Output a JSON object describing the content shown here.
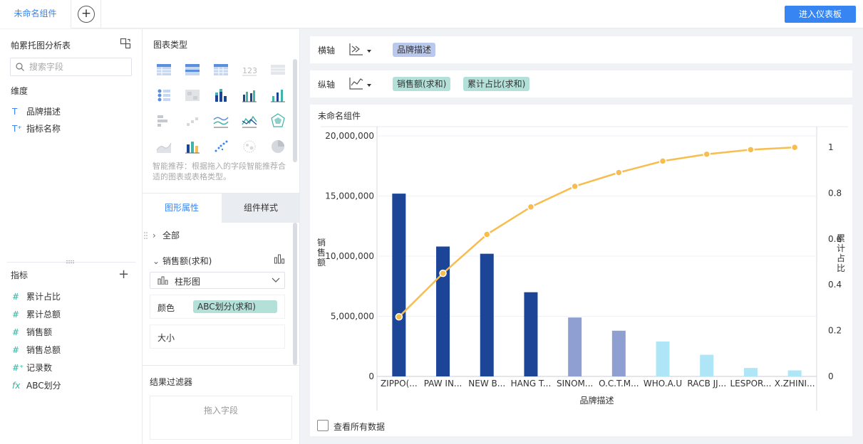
{
  "topbar": {
    "active_tab": "未命名组件",
    "add_tab_symbol": "+",
    "enter_dashboard": "进入仪表板"
  },
  "left_panel": {
    "table_name": "帕累托图分析表",
    "search_placeholder": "搜索字段",
    "dimension_title": "维度",
    "dimensions": [
      {
        "icon": "T",
        "label": "品牌描述"
      },
      {
        "icon": "T⁺",
        "label": "指标名称"
      }
    ],
    "metric_title": "指标",
    "metrics": [
      {
        "icon": "#",
        "label": "累计占比"
      },
      {
        "icon": "#",
        "label": "累计总额"
      },
      {
        "icon": "#",
        "label": "销售额"
      },
      {
        "icon": "#",
        "label": "销售总额"
      },
      {
        "icon": "#⁺",
        "label": "记录数"
      },
      {
        "icon": "fx",
        "label": "ABC划分"
      }
    ]
  },
  "mid_panel": {
    "chart_type_title": "图表类型",
    "smart_tip": "智能推荐：根据拖入的字段智能推荐合适的图表或表格类型。",
    "tab_graph_props": "图形属性",
    "tab_component_style": "组件样式",
    "all_label": "全部",
    "series_label": "销售额(求和)",
    "chart_kind": "柱形图",
    "color_label": "颜色",
    "color_field": "ABC划分(求和)",
    "size_label": "大小",
    "filter_title": "结果过滤器",
    "filter_drop": "拖入字段"
  },
  "right_panel": {
    "x_axis_label": "横轴",
    "x_axis_field": "品牌描述",
    "y_axis_label": "纵轴",
    "y_axis_fields": [
      "销售额(求和)",
      "累计占比(求和)"
    ],
    "chart_title": "未命名组件",
    "show_all_label": "查看所有数据"
  },
  "chart_data": {
    "type": "bar",
    "xlabel": "品牌描述",
    "ylabel": "销售额",
    "y2label": "累计占比",
    "categories": [
      "ZIPPO(...",
      "PAW IN...",
      "NEW B...",
      "HANG T...",
      "SINOM...",
      "O.C.T.M...",
      "WHO.A.U",
      "RACB JJ...",
      "LESPOR...",
      "X.ZHINI..."
    ],
    "ylim": [
      0,
      20000000
    ],
    "yticks": [
      "20,000,000",
      "15,000,000",
      "10,000,000",
      "5,000,000",
      "0"
    ],
    "y2lim": [
      0,
      1.05
    ],
    "y2ticks": [
      "1",
      "0.8",
      "0.6",
      "0.4",
      "0.2",
      "0"
    ],
    "series": [
      {
        "name": "销售额(求和)",
        "kind": "bar",
        "values": [
          15200000,
          10800000,
          10200000,
          7000000,
          4900000,
          3800000,
          2900000,
          1800000,
          700000,
          500000
        ]
      },
      {
        "name": "累计占比(求和)",
        "kind": "line",
        "axis": "right",
        "values": [
          0.26,
          0.45,
          0.62,
          0.74,
          0.83,
          0.89,
          0.94,
          0.97,
          0.99,
          1.0
        ]
      }
    ],
    "bar_colors": [
      "#1c4597",
      "#1c4597",
      "#1c4597",
      "#1c4597",
      "#8f9fd2",
      "#8f9fd2",
      "#aee6f7",
      "#aee6f7",
      "#aee6f7",
      "#aee6f7"
    ],
    "line_color": "#f7bd4f",
    "grid": true
  }
}
